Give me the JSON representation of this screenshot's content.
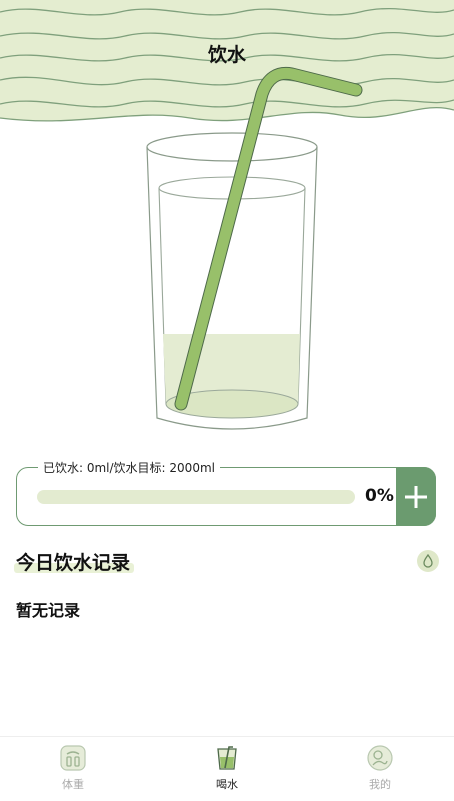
{
  "header": {
    "title": "饮水"
  },
  "glass": {
    "fill_level_percent": 0
  },
  "progress": {
    "legend": "已饮水: 0ml/饮水目标: 2000ml",
    "percent_text": "0%",
    "percent_value": 0
  },
  "records": {
    "title": "今日饮水记录",
    "empty_text": "暂无记录"
  },
  "tabbar": {
    "tabs": [
      {
        "label": "体重",
        "icon": "scale-icon",
        "active": false
      },
      {
        "label": "喝水",
        "icon": "water-glass-icon",
        "active": true
      },
      {
        "label": "我的",
        "icon": "profile-icon",
        "active": false
      }
    ]
  },
  "colors": {
    "accent": "#6b9b6f",
    "wave_bg": "#e4edd0",
    "straw": "#98c06a",
    "water": "#e4ecd2"
  }
}
